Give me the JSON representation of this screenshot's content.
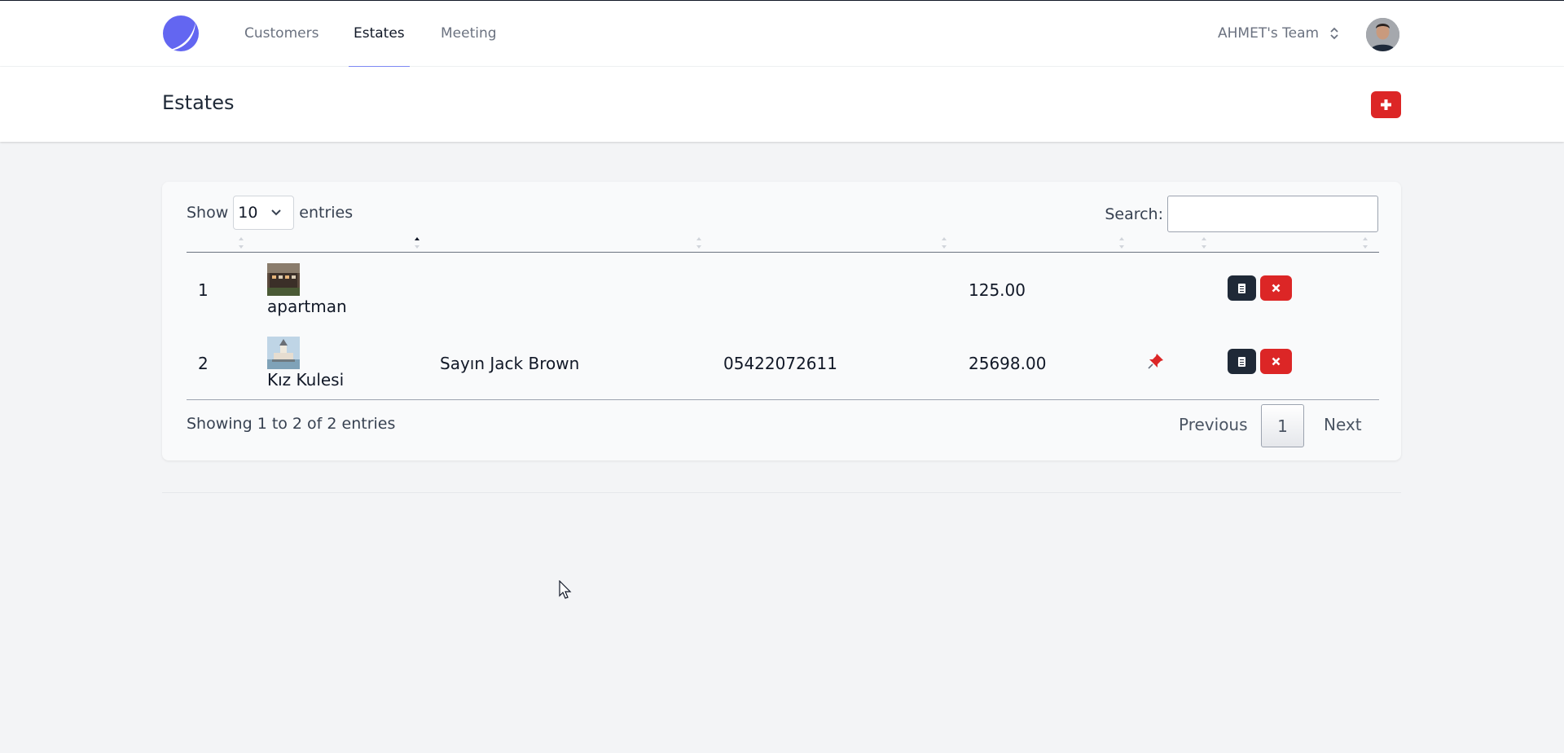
{
  "nav": {
    "links": [
      {
        "label": "Customers",
        "active": false
      },
      {
        "label": "Estates",
        "active": true
      },
      {
        "label": "Meeting",
        "active": false
      }
    ],
    "team_name": "AHMET's Team",
    "brand_color": "#6366f1"
  },
  "header": {
    "title": "Estates",
    "add_icon": "plus-icon"
  },
  "table": {
    "length_label_prefix": "Show",
    "length_value": "10",
    "length_label_suffix": "entries",
    "search_label": "Search:",
    "search_value": "",
    "rows": [
      {
        "no": "1",
        "title": "apartman",
        "owner": "",
        "phone": "",
        "price": "125.00",
        "pinned": false
      },
      {
        "no": "2",
        "title": "Kız Kulesi",
        "owner": "Sayın Jack Brown",
        "phone": "05422072611",
        "price": "25698.00",
        "pinned": true
      }
    ],
    "info": "Showing 1 to 2 of 2 entries",
    "pagination": {
      "previous": "Previous",
      "current": "1",
      "next": "Next"
    }
  },
  "colors": {
    "danger": "#dc2626",
    "dark": "#1f2937",
    "accent": "#818cf8"
  }
}
